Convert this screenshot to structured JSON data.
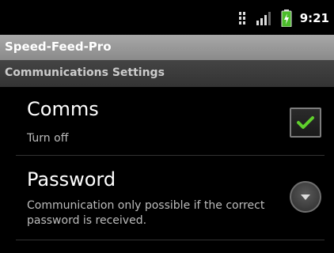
{
  "status_bar": {
    "time": "9:21",
    "icons": [
      "data-3g-icon",
      "signal-strength-icon",
      "battery-charging-icon"
    ]
  },
  "app": {
    "title": "Speed-Feed-Pro"
  },
  "category": {
    "label": "Communications Settings"
  },
  "preferences": [
    {
      "title": "Comms",
      "summary": "Turn off",
      "widget": "checkbox",
      "checked": true
    },
    {
      "title": "Password",
      "summary": "Communication only possible if the correct password is received.",
      "widget": "dropdown"
    }
  ],
  "colors": {
    "check_green": "#5fcf2c",
    "title_bar": "#9a9a9a",
    "category_bar": "#3a3a3a"
  }
}
